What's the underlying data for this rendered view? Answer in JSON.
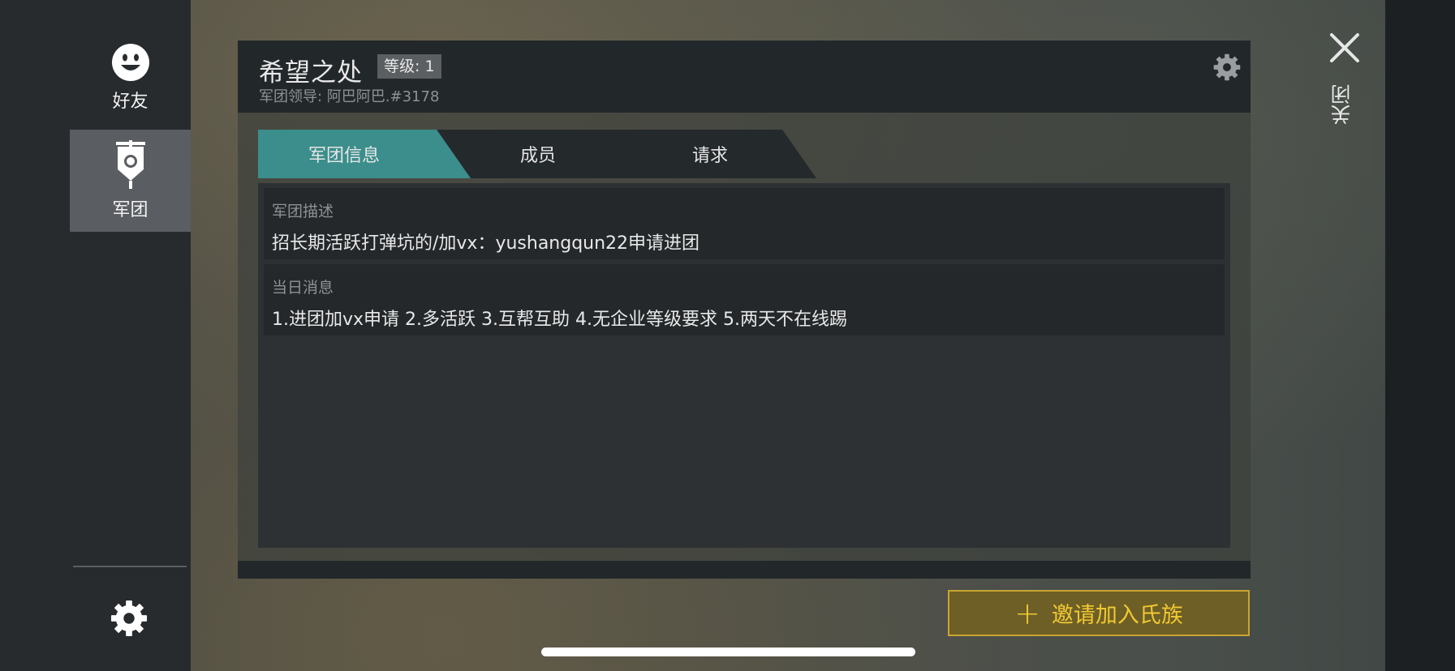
{
  "sidebar": {
    "friends_label": "好友",
    "legion_label": "军团",
    "icons": [
      "smiley-icon",
      "legion-banner-icon",
      "gear-icon"
    ]
  },
  "header": {
    "clan_name": "希望之处",
    "level_label": "等级: 1",
    "leader_prefix": "军团领导: ",
    "leader_name": "阿巴阿巴.#3178"
  },
  "tabs": [
    {
      "label": "军团信息",
      "active": true
    },
    {
      "label": "成员",
      "active": false
    },
    {
      "label": "请求",
      "active": false
    }
  ],
  "info": {
    "description_label": "军团描述",
    "description_text": "招长期活跃打弹坑的/加vx：yushangqun22申请进团",
    "daily_label": "当日消息",
    "daily_text": "1.进团加vx申请 2.多活跃 3.互帮互助 4.无企业等级要求 5.两天不在线踢"
  },
  "invite_button": {
    "icon": "plus-icon",
    "label": "邀请加入氏族"
  },
  "close": {
    "icon": "close-icon",
    "label": "关闭"
  },
  "colors": {
    "accent_teal": "#3b8e8b",
    "invite_gold": "#f1c832",
    "invite_bg": "#6d5f26",
    "sidebar_bg": "#272b2e"
  }
}
